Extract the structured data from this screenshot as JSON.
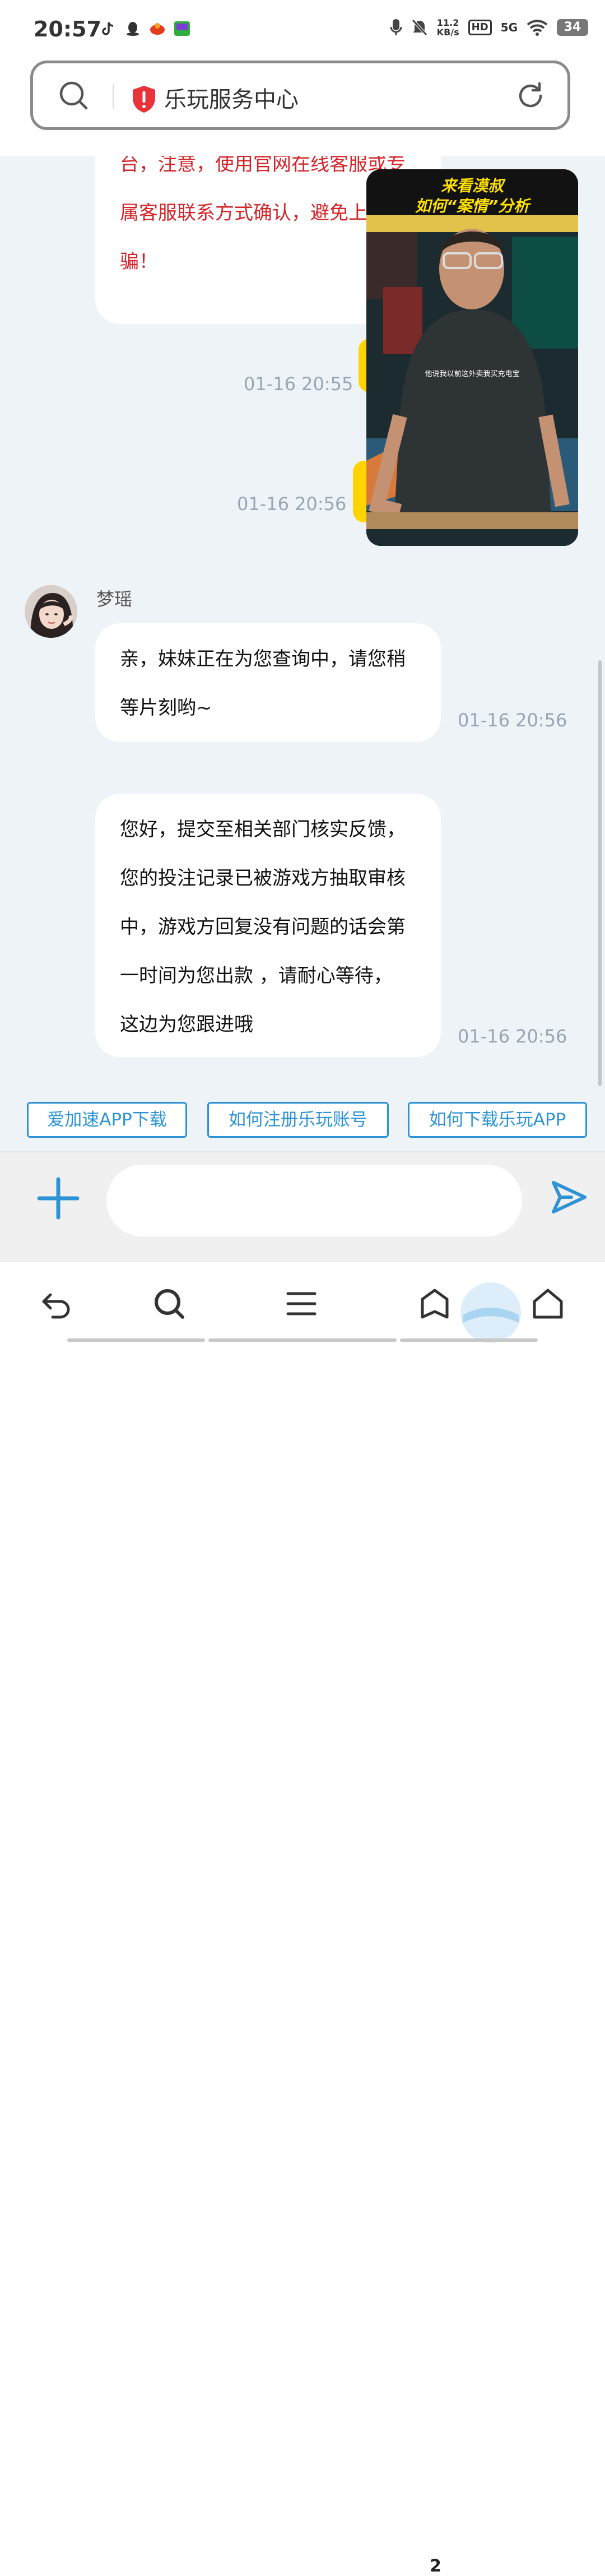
{
  "status_bar": {
    "time": "20:57",
    "net_speed_value": "11.2",
    "net_speed_unit": "KB/s",
    "hd_label": "HD",
    "network_label": "5G",
    "battery": "34"
  },
  "browser": {
    "page_title": "乐玩服务中心"
  },
  "chat": {
    "warning_message": {
      "lines": [
        "台，注意，使用官网在线客服或专",
        "属客服联系方式确认，避免上",
        "骗！"
      ]
    },
    "user_timestamps": [
      "01-16 20:55",
      "01-16 20:56"
    ],
    "agent": {
      "name": "梦瑶"
    },
    "agent_messages": [
      {
        "lines": [
          "亲，妹妹正在为您查询中，请您稍",
          "等片刻哟~"
        ],
        "time": "01-16 20:56"
      },
      {
        "lines": [
          "您好，提交至相关部门核实反馈，",
          "您的投注记录已被游戏方抽取审核",
          "中，游戏方回复没有问题的话会第",
          "一时间为您出款 ，请耐心等待，",
          "这边为您跟进哦"
        ],
        "time": "01-16 20:56"
      }
    ]
  },
  "video_overlay": {
    "caption_line1": "来看漠叔",
    "caption_line2": "如何“案情”分析",
    "subtitle": "他说我以前这外卖我买充电宝"
  },
  "quick_replies": [
    "爱加速APP下载",
    "如何注册乐玩账号",
    "如何下载乐玩APP"
  ],
  "composer": {
    "placeholder": ""
  },
  "bottom_nav": {
    "tab_count": "2"
  },
  "colors": {
    "accent": "#2e93d4",
    "warning_text": "#d3242a",
    "chat_bg": "#eef3f7",
    "user_bubble": "#ffd400"
  }
}
